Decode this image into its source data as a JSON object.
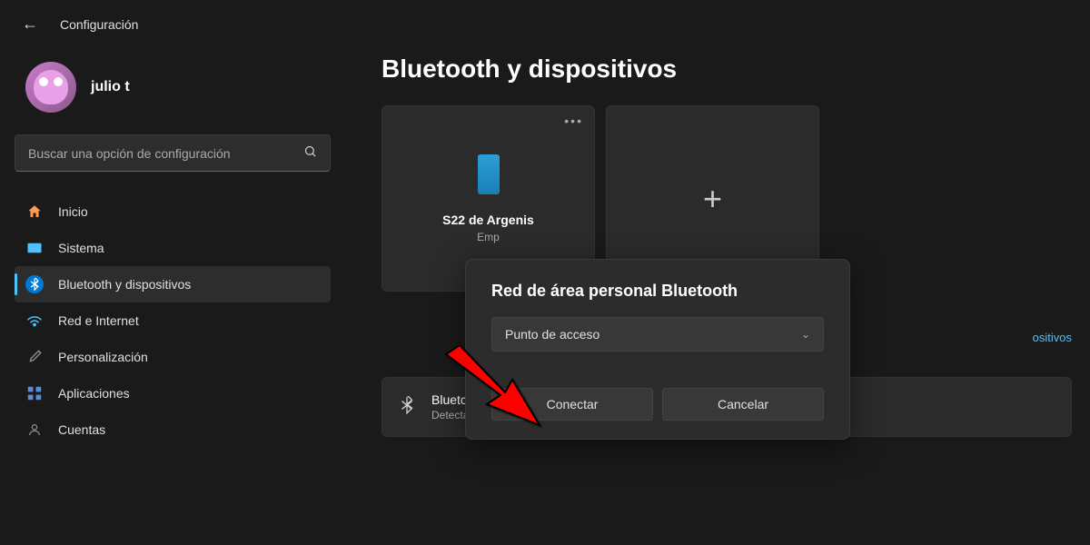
{
  "header": {
    "title": "Configuración"
  },
  "user": {
    "name": "julio t"
  },
  "search": {
    "placeholder": "Buscar una opción de configuración"
  },
  "sidebar": {
    "items": [
      {
        "label": "Inicio",
        "icon": "home"
      },
      {
        "label": "Sistema",
        "icon": "system"
      },
      {
        "label": "Bluetooth y dispositivos",
        "icon": "bluetooth",
        "active": true
      },
      {
        "label": "Red e Internet",
        "icon": "network"
      },
      {
        "label": "Personalización",
        "icon": "brush"
      },
      {
        "label": "Aplicaciones",
        "icon": "apps"
      },
      {
        "label": "Cuentas",
        "icon": "accounts"
      }
    ]
  },
  "main": {
    "title": "Bluetooth y dispositivos",
    "device": {
      "name": "S22 de Argenis",
      "status": "Emp"
    },
    "link_text": "ositivos",
    "bluetooth_row": {
      "title": "Bluetc",
      "subtitle": "Detectable al JULIOT"
    }
  },
  "dialog": {
    "title": "Red de área personal Bluetooth",
    "dropdown_selected": "Punto de acceso",
    "connect_label": "Conectar",
    "cancel_label": "Cancelar"
  }
}
